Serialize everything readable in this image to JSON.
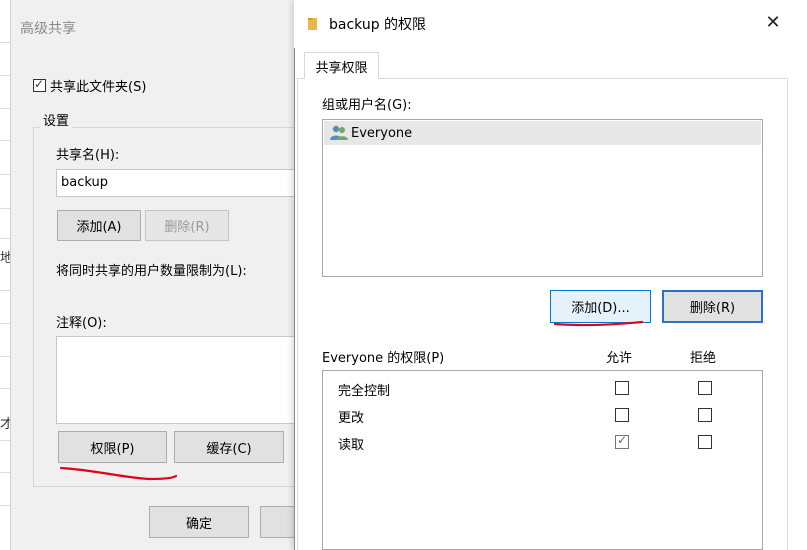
{
  "left_dialog": {
    "title": "高级共享",
    "share_checkbox_label": "共享此文件夹(S)",
    "share_checked": true,
    "settings_group_label": "设置",
    "share_name_label": "共享名(H):",
    "share_name_value": "backup",
    "add_button": "添加(A)",
    "delete_button": "删除(R)",
    "limit_label": "将同时共享的用户数量限制为(L):",
    "comment_label": "注释(O):",
    "comment_value": "",
    "permissions_button": "权限(P)",
    "cache_button": "缓存(C)",
    "ok_button": "确定"
  },
  "behind_window": {
    "glyph_1": "地",
    "glyph_2": "才"
  },
  "right_dialog": {
    "title": "backup 的权限",
    "folder_icon": "folder-icon",
    "close_icon": "close-icon",
    "tab_label": "共享权限",
    "group_label": "组或用户名(G):",
    "users": [
      {
        "name": "Everyone",
        "icon": "users-group-icon"
      }
    ],
    "add_button": "添加(D)...",
    "remove_button": "删除(R)",
    "permissions_for_label": "Everyone 的权限(P)",
    "allow_header": "允许",
    "deny_header": "拒绝",
    "permissions": [
      {
        "name": "完全控制",
        "allow": false,
        "deny": false
      },
      {
        "name": "更改",
        "allow": false,
        "deny": false
      },
      {
        "name": "读取",
        "allow": true,
        "deny": false
      }
    ]
  },
  "colors": {
    "annotation_red": "#e3001b",
    "focus_blue": "#2a72c8",
    "folder_yellow": "#e8b84a"
  }
}
